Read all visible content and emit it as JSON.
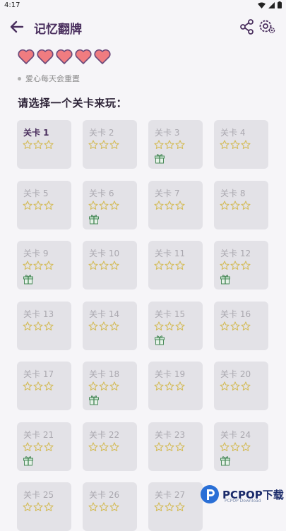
{
  "status": {
    "time": "4:17"
  },
  "header": {
    "title": "记忆翻牌"
  },
  "hearts": {
    "count": 5,
    "color": "#f07c80"
  },
  "note": "爱心每天会重置",
  "choose_label": "请选择一个关卡来玩：",
  "levels": [
    {
      "label": "关卡 1",
      "gift": false,
      "active": true
    },
    {
      "label": "关卡 2",
      "gift": false,
      "active": false
    },
    {
      "label": "关卡 3",
      "gift": true,
      "active": false
    },
    {
      "label": "关卡 4",
      "gift": false,
      "active": false
    },
    {
      "label": "关卡 5",
      "gift": false,
      "active": false
    },
    {
      "label": "关卡 6",
      "gift": true,
      "active": false
    },
    {
      "label": "关卡 7",
      "gift": false,
      "active": false
    },
    {
      "label": "关卡 8",
      "gift": false,
      "active": false
    },
    {
      "label": "关卡 9",
      "gift": true,
      "active": false
    },
    {
      "label": "关卡 10",
      "gift": false,
      "active": false
    },
    {
      "label": "关卡 11",
      "gift": false,
      "active": false
    },
    {
      "label": "关卡 12",
      "gift": true,
      "active": false
    },
    {
      "label": "关卡 13",
      "gift": false,
      "active": false
    },
    {
      "label": "关卡 14",
      "gift": false,
      "active": false
    },
    {
      "label": "关卡 15",
      "gift": true,
      "active": false
    },
    {
      "label": "关卡 16",
      "gift": false,
      "active": false
    },
    {
      "label": "关卡 17",
      "gift": false,
      "active": false
    },
    {
      "label": "关卡 18",
      "gift": true,
      "active": false
    },
    {
      "label": "关卡 19",
      "gift": false,
      "active": false
    },
    {
      "label": "关卡 20",
      "gift": false,
      "active": false
    },
    {
      "label": "关卡 21",
      "gift": true,
      "active": false
    },
    {
      "label": "关卡 22",
      "gift": false,
      "active": false
    },
    {
      "label": "关卡 23",
      "gift": false,
      "active": false
    },
    {
      "label": "关卡 24",
      "gift": true,
      "active": false
    },
    {
      "label": "关卡 25",
      "gift": false,
      "active": false
    },
    {
      "label": "关卡 26",
      "gift": false,
      "active": false
    },
    {
      "label": "关卡 27",
      "gift": false,
      "active": false
    }
  ],
  "watermark": {
    "text": "PCPOP下载",
    "sub": "PCPOP Download"
  }
}
